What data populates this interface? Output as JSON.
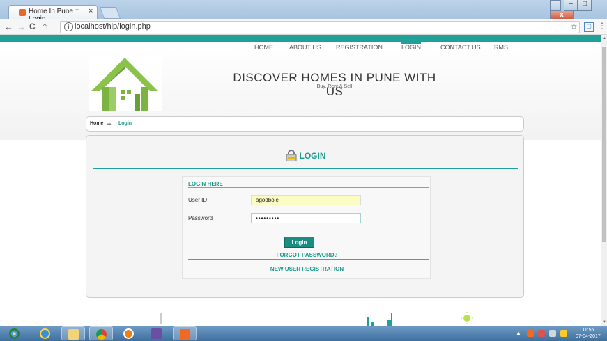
{
  "browser": {
    "tab_title": "Home In Pune :: Login",
    "tab_close": "×",
    "url": "localhost/hip/login.php",
    "back": "←",
    "forward": "→",
    "reload": "C",
    "home": "⌂",
    "star": "☆",
    "menu": "⋮",
    "win_min": "–",
    "win_max": "□",
    "win_close": "x"
  },
  "nav": {
    "items": [
      "HOME",
      "ABOUT US",
      "REGISTRATION",
      "LOGIN",
      "CONTACT US",
      "RMS"
    ],
    "active": "LOGIN"
  },
  "header": {
    "headline": "DISCOVER HOMES IN PUNE WITH US",
    "tagline": "Buy, Rent & Sell"
  },
  "breadcrumb": {
    "home": "Home",
    "current": "Login"
  },
  "login": {
    "title": "LOGIN",
    "section": "LOGIN HERE",
    "user_label": "User ID",
    "user_value": "agodbole",
    "pass_label": "Password",
    "pass_value": "•••••••••",
    "button": "Login",
    "forgot": "FORGOT PASSWORD?",
    "register": "NEW USER REGISTRATION"
  },
  "taskbar": {
    "time": "11:55",
    "date": "07-04-2017"
  },
  "colors": {
    "accent": "#1fa19a",
    "button": "#1a8d83",
    "input_highlight": "#fbfcc2",
    "logo_green": "#7cb342"
  }
}
